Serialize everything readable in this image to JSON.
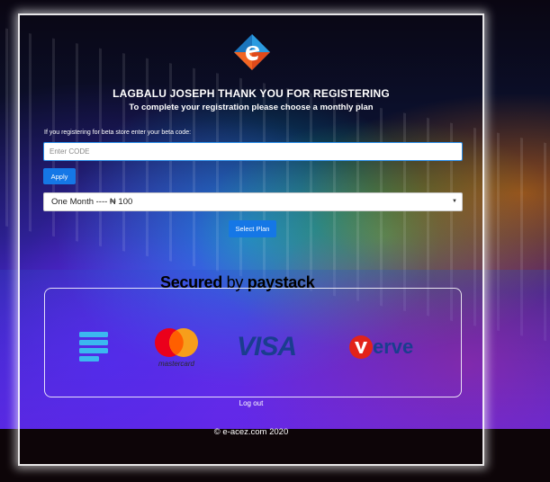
{
  "header": {
    "title": "LAGBALU JOSEPH THANK YOU FOR REGISTERING",
    "subtitle": "To complete your registration please choose a monthly plan"
  },
  "beta": {
    "label": "If you registering for beta store enter your beta code:",
    "placeholder": "Enter CODE",
    "value": "",
    "apply_label": "Apply"
  },
  "plan": {
    "selected": "One Month ---- ₦ 100",
    "select_label": "Select Plan"
  },
  "payment": {
    "secured_prefix": "Secured",
    "secured_by": "by",
    "secured_brand": "paystack",
    "methods": [
      "paystack-icon",
      "mastercard-logo",
      "visa-logo",
      "verve-logo"
    ],
    "mastercard_text": "mastercard",
    "visa_text": "VISA",
    "verve_text": "erve"
  },
  "footer": {
    "logout": "Log out",
    "copyright": "© e-acez.com 2020"
  },
  "colors": {
    "accent": "#1577e6",
    "logo_orange": "#f26522",
    "logo_blue": "#1b75bc"
  }
}
